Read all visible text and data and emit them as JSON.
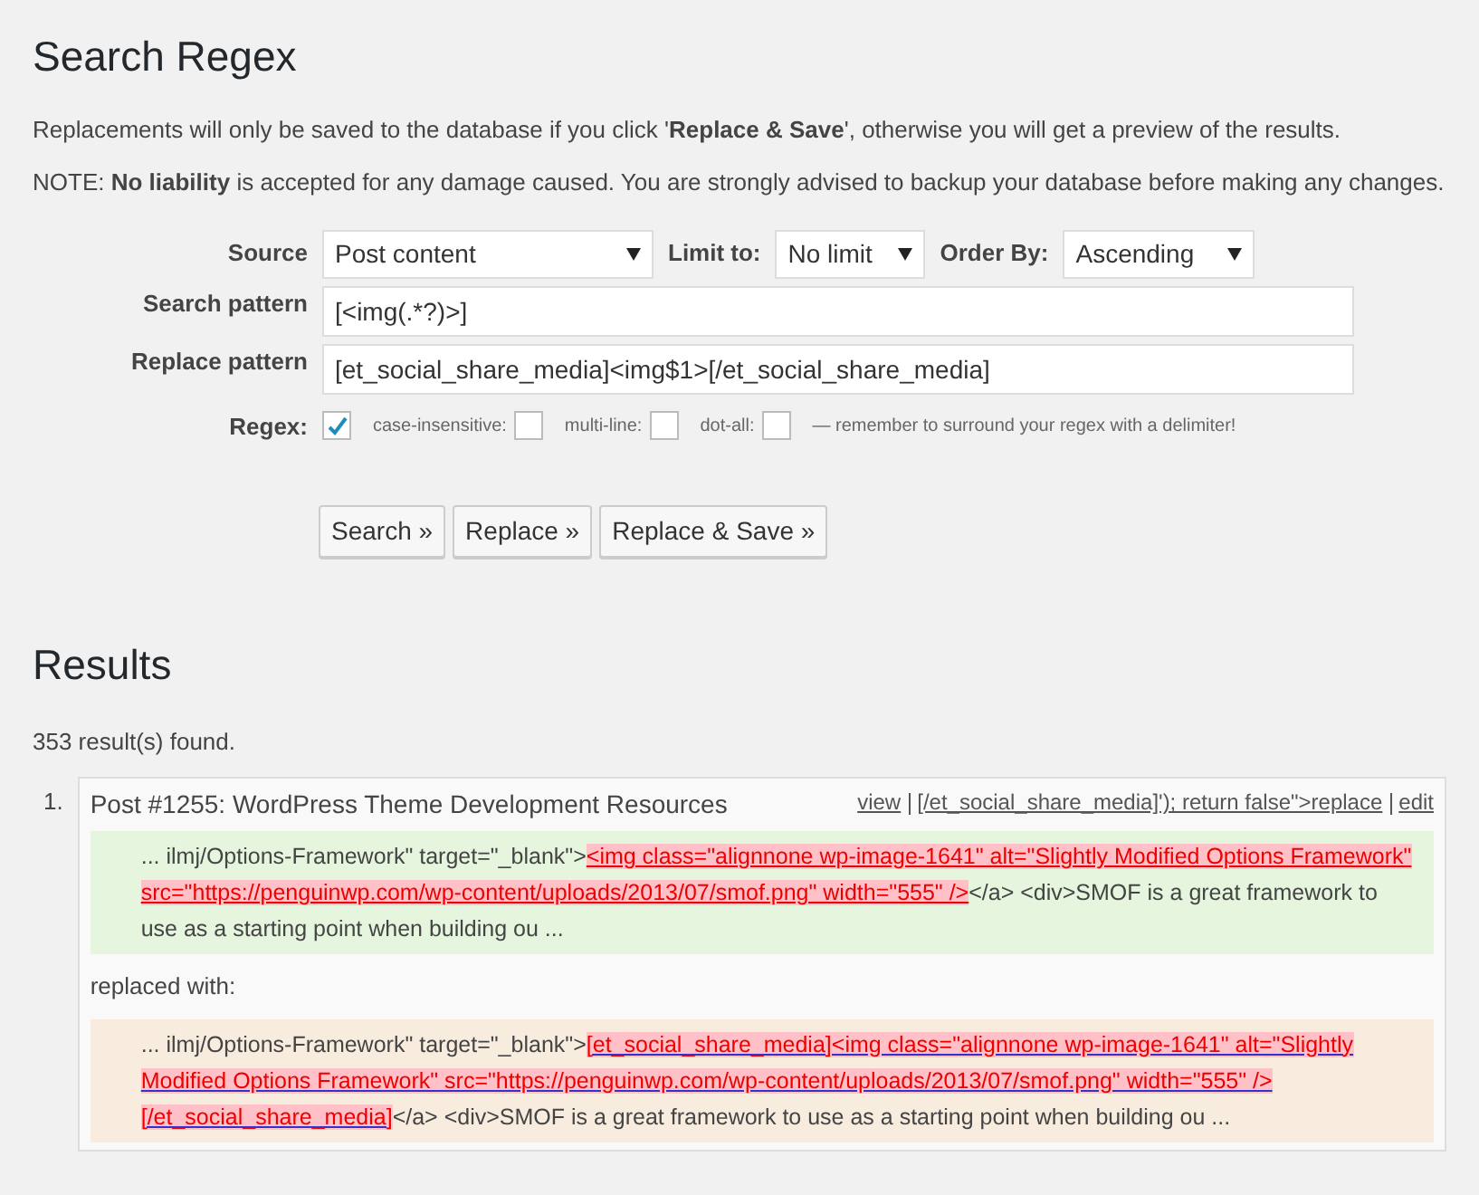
{
  "title": "Search Regex",
  "intro": "Replacements will only be saved to the database if you click '**Replace & Save**', otherwise you will get a preview of the results.",
  "note": "NOTE: **No liability** is accepted for any damage caused. You are strongly advised to backup your database before making any changes.",
  "form": {
    "source": {
      "label": "Source",
      "value": "Post content"
    },
    "limit": {
      "label": "Limit to:",
      "value": "No limit"
    },
    "order": {
      "label": "Order By:",
      "value": "Ascending"
    },
    "search_pattern": {
      "label": "Search pattern",
      "value": "[<img(.*?)>]"
    },
    "replace_pattern": {
      "label": "Replace pattern",
      "value": "[et_social_share_media]<img$1>[/et_social_share_media]"
    },
    "regex": {
      "label": "Regex:",
      "checked": true
    },
    "options": [
      {
        "label": "case-insensitive:",
        "checked": false
      },
      {
        "label": "multi-line:",
        "checked": false
      },
      {
        "label": "dot-all:",
        "checked": false
      }
    ],
    "hint": "— remember to surround your regex with a delimiter!",
    "buttons": [
      "Search »",
      "Replace »",
      "Replace & Save »"
    ]
  },
  "results": {
    "title": "Results",
    "count": "353 result(s) found.",
    "items": [
      {
        "number": "1.",
        "title": "Post #1255: WordPress Theme Development Resources",
        "actions": [
          "view",
          "[/et_social_share_media]'); return false\">replace",
          "edit"
        ],
        "excerpts": [
          {
            "kind": "original",
            "segments": [
              {
                "text": "... ilmj/Options-Framework\" target=\"_blank\">",
                "highlighted": false
              },
              {
                "text": "<img class=\"alignnone wp-image-1641\" alt=\"Slightly Modified Options Framework\" src=\"https://penguinwp.com/wp-content/uploads/2013/07/smof.png\" width=\"555\" />",
                "highlighted": true
              },
              {
                "text": "</a> <div>SMOF is a great framework to use as a starting point when building ou ...",
                "highlighted": false
              }
            ]
          },
          {
            "kind": "label",
            "text": "replaced with:"
          },
          {
            "kind": "replaced",
            "segments": [
              {
                "text": "... ilmj/Options-Framework\" target=\"_blank\">",
                "highlighted": false
              },
              {
                "text": "[et_social_share_media]<img class=\"alignnone wp-image-1641\" alt=\"Slightly Modified Options Framework\" src=\"https://penguinwp.com/wp-content/uploads/2013/07/smof.png\" width=\"555\" /> [/et_social_share_media]",
                "highlighted": true
              },
              {
                "text": "</a> <div>SMOF is a great framework to use as a starting point when building ou ...",
                "highlighted": false
              }
            ]
          }
        ]
      }
    ]
  }
}
